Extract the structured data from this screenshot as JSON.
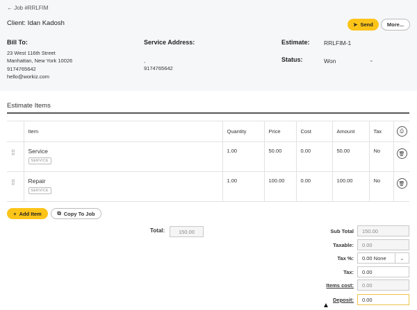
{
  "header": {
    "back_label": "← Job #RRLFIM",
    "client": "Client: Idan Kadosh",
    "send_label": "Send",
    "more_label": "More..."
  },
  "bill_to": {
    "label": "Bill To:",
    "lines": [
      "23 West 116th Street",
      "Manhattan, New York 10026",
      "9174765642",
      "hello@workiz.com"
    ]
  },
  "service_address": {
    "label": "Service Address:",
    "lines": [
      ",",
      "9174765642"
    ]
  },
  "estimate": {
    "label": "Estimate:",
    "value": "RRLFIM-1",
    "status_label": "Status:",
    "status_value": "Won"
  },
  "items_section": {
    "title": "Estimate Items",
    "columns": [
      "Item",
      "Quantity",
      "Price",
      "Cost",
      "Amount",
      "Tax"
    ],
    "rows": [
      {
        "name": "Service",
        "tag": "SERVICE",
        "quantity": "1.00",
        "price": "50.00",
        "cost": "0.00",
        "amount": "50.00",
        "tax": "No"
      },
      {
        "name": "Repair",
        "tag": "SERVICE",
        "quantity": "1.00",
        "price": "100.00",
        "cost": "0.00",
        "amount": "100.00",
        "tax": "No"
      }
    ]
  },
  "actions": {
    "add_item": "Add Item",
    "copy_to_job": "Copy To Job"
  },
  "totals": {
    "total_label": "Total:",
    "total_value": "150.00",
    "sub_total_label": "Sub Total",
    "sub_total_value": "150.00",
    "taxable_label": "Taxable:",
    "taxable_value": "0.00",
    "tax_pct_label": "Tax %:",
    "tax_pct_value": "0.00 None",
    "tax_label": "Tax:",
    "tax_value": "0.00",
    "items_cost_label": "Items cost:",
    "items_cost_value": "0.00",
    "deposit_label": "Deposit:",
    "deposit_value": "0.00"
  },
  "colors": {
    "accent": "#fcc419",
    "header_bg": "#f6f7f9"
  }
}
